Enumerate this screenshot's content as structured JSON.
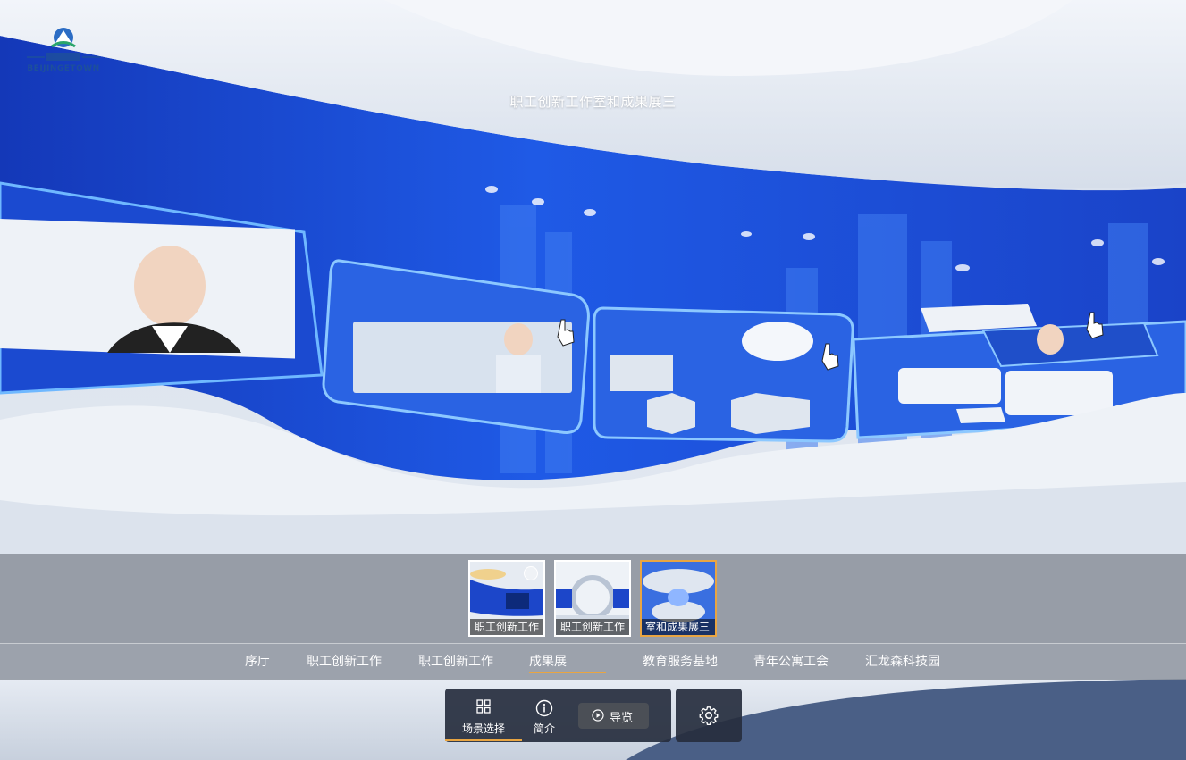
{
  "app": {
    "logo_text": "BEIJINGETOWN",
    "scene_title": "职工创新工作室和成果展三"
  },
  "thumbnails": [
    {
      "label": "职工创新工作",
      "checked": true,
      "active": false
    },
    {
      "label": "职工创新工作",
      "checked": false,
      "active": false
    },
    {
      "label": "室和成果展三",
      "checked": false,
      "active": true
    }
  ],
  "categories": [
    {
      "label": "序厅",
      "active": false
    },
    {
      "label": "职工创新工作",
      "active": false
    },
    {
      "label": "职工创新工作",
      "active": false
    },
    {
      "label": "成果展",
      "active": true
    },
    {
      "label": "教育服务基地",
      "active": false
    },
    {
      "label": "青年公寓工会",
      "active": false
    },
    {
      "label": "汇龙森科技园",
      "active": false
    }
  ],
  "toolbar": {
    "scene_select_label": "场景选择",
    "intro_label": "简介",
    "tour_label": "导览"
  },
  "colors": {
    "accent": "#e9a542",
    "panel_blue": "#1a4fd8",
    "toolbar_bg": "#262e3e"
  },
  "icons": {
    "scene_select": "grid-icon",
    "intro": "info-icon",
    "tour": "play-circle-icon",
    "settings": "gear-icon",
    "thumb_check": "check-icon"
  }
}
